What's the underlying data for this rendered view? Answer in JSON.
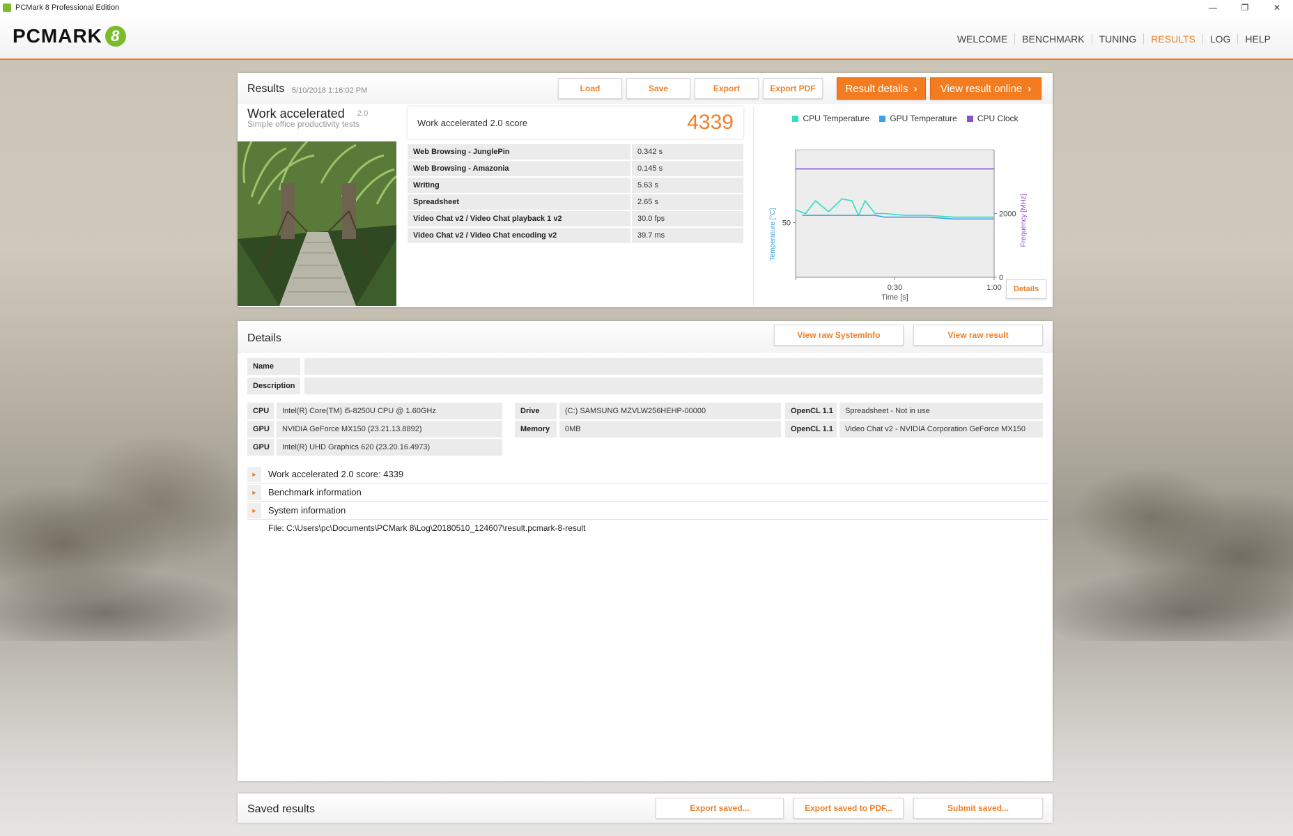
{
  "window": {
    "title": "PCMark 8 Professional Edition",
    "controls": [
      "—",
      "❐",
      "✕"
    ]
  },
  "header": {
    "logo_text": "PCMARK",
    "logo_badge": "8",
    "nav": [
      {
        "label": "WELCOME",
        "active": false
      },
      {
        "label": "BENCHMARK",
        "active": false
      },
      {
        "label": "TUNING",
        "active": false
      },
      {
        "label": "RESULTS",
        "active": true
      },
      {
        "label": "LOG",
        "active": false
      },
      {
        "label": "HELP",
        "active": false
      }
    ],
    "accent": "#f07f27"
  },
  "results": {
    "title": "Results",
    "date": "5/10/2018 1:16:02 PM",
    "buttons": {
      "load": "Load",
      "save": "Save",
      "export": "Export",
      "export_pdf": "Export PDF",
      "result_details": "Result details",
      "view_online": "View result online"
    },
    "benchmark": {
      "name": "Work accelerated",
      "version": "2.0",
      "subtitle": "Simple office productivity tests"
    },
    "score_label": "Work accelerated 2.0 score",
    "score_value": "4339",
    "subtests": [
      {
        "name": "Web Browsing - JunglePin",
        "value": "0.342 s"
      },
      {
        "name": "Web Browsing - Amazonia",
        "value": "0.145 s"
      },
      {
        "name": "Writing",
        "value": "5.63 s"
      },
      {
        "name": "Spreadsheet",
        "value": "2.65 s"
      },
      {
        "name": "Video Chat v2 / Video Chat playback 1 v2",
        "value": "30.0 fps"
      },
      {
        "name": "Video Chat v2 / Video Chat encoding v2",
        "value": "39.7 ms"
      }
    ],
    "details_button": "Details"
  },
  "chart_data": {
    "type": "line",
    "legend": [
      {
        "name": "CPU Temperature",
        "color": "#2ee0c0"
      },
      {
        "name": "GPU Temperature",
        "color": "#3aa0e6"
      },
      {
        "name": "CPU Clock",
        "color": "#8a4fd0"
      }
    ],
    "xlabel": "Time [s]",
    "ylabel_left": "Temperature [°C]",
    "ylabel_right": "Frequency [MHz]",
    "x_ticks": [
      "0:30",
      "1:00"
    ],
    "y_left_ticks": [
      "50"
    ],
    "y_right_ticks": [
      "2000",
      "0"
    ],
    "xlim": [
      0,
      60
    ],
    "ylim_left": [
      20,
      90
    ],
    "ylim_right": [
      0,
      4000
    ],
    "series": [
      {
        "name": "CPU Temperature",
        "axis": "left",
        "x": [
          0,
          3,
          6,
          10,
          14,
          17,
          19,
          21,
          24,
          27,
          33,
          40,
          48,
          56,
          60
        ],
        "y": [
          57,
          55,
          62,
          56,
          63,
          62,
          54,
          62,
          55,
          55,
          54,
          54,
          53,
          53,
          53
        ]
      },
      {
        "name": "GPU Temperature",
        "axis": "left",
        "x": [
          2,
          8,
          16,
          24,
          27,
          33,
          40,
          48,
          56,
          60
        ],
        "y": [
          54,
          54,
          54,
          54,
          53,
          53,
          53,
          52,
          52,
          52
        ]
      },
      {
        "name": "CPU Clock",
        "axis": "right",
        "x": [
          0,
          60
        ],
        "y": [
          3400,
          3400
        ]
      }
    ]
  },
  "details": {
    "title": "Details",
    "buttons": {
      "raw_sysinfo": "View raw SystemInfo",
      "raw_result": "View raw result"
    },
    "name_label": "Name",
    "name_value": "",
    "desc_label": "Description",
    "desc_value": "",
    "hw": {
      "cpu_label": "CPU",
      "cpu": "Intel(R) Core(TM) i5-8250U CPU @ 1.60GHz",
      "gpu1_label": "GPU",
      "gpu1": "NVIDIA GeForce MX150 (23.21.13.8892)",
      "gpu2_label": "GPU",
      "gpu2": "Intel(R) UHD Graphics 620 (23.20.16.4973)",
      "drive_label": "Drive",
      "drive": "(C:) SAMSUNG MZVLW256HEHP-00000",
      "memory_label": "Memory",
      "memory": "0MB",
      "opencl1_label": "OpenCL 1.1",
      "opencl1": "Spreadsheet - Not in use",
      "opencl2_label": "OpenCL 1.1",
      "opencl2": "Video Chat v2 - NVIDIA Corporation GeForce MX150"
    },
    "tree": [
      "Work accelerated 2.0 score: 4339",
      "Benchmark information",
      "System information"
    ],
    "file": "File: C:\\Users\\pc\\Documents\\PCMark 8\\Log\\20180510_124607\\result.pcmark-8-result"
  },
  "saved": {
    "title": "Saved results",
    "buttons": {
      "export_saved": "Export saved...",
      "export_saved_pdf": "Export saved to PDF...",
      "submit_saved": "Submit saved..."
    }
  }
}
